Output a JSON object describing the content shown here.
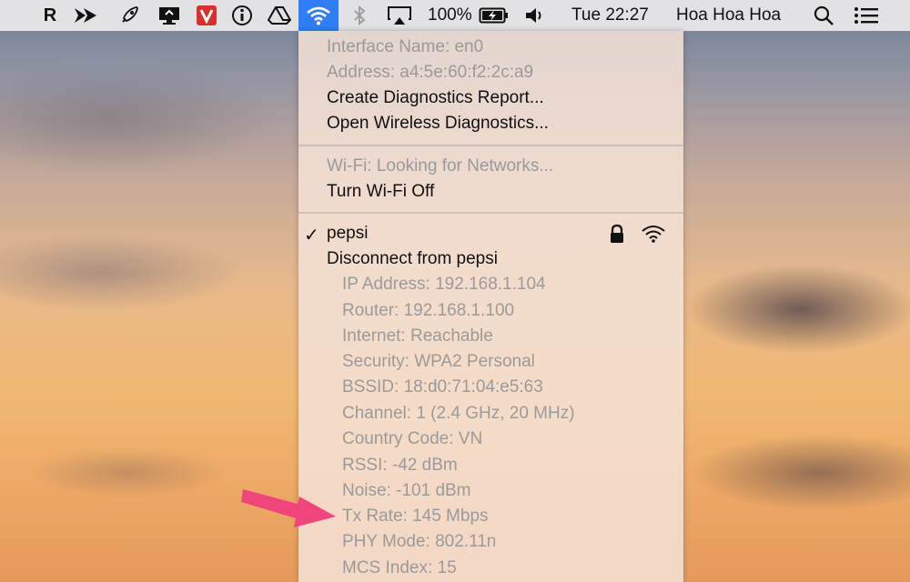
{
  "menubar": {
    "r_label": "R",
    "battery": "100%",
    "clock": "Tue 22:27",
    "user": "Hoa Hoa Hoa",
    "icons": [
      "r-app-icon",
      "forward-icon",
      "rocket-icon",
      "display-sync-icon",
      "vivaldi-icon",
      "info-icon",
      "google-drive-icon",
      "wifi-icon",
      "bluetooth-icon",
      "airplay-icon",
      "battery-charging-icon",
      "volume-icon",
      "spotlight-icon",
      "notification-center-icon"
    ]
  },
  "menu": {
    "interface_name": "Interface Name: en0",
    "address": "Address: a4:5e:60:f2:2c:a9",
    "create_report": "Create Diagnostics Report...",
    "open_diagnostics": "Open Wireless Diagnostics...",
    "wifi_status": "Wi-Fi: Looking for Networks...",
    "turn_off": "Turn Wi-Fi Off",
    "checkmark": "✓",
    "network_name": "pepsi",
    "disconnect": "Disconnect from pepsi",
    "details": {
      "ip": "IP Address: 192.168.1.104",
      "router": "Router: 192.168.1.100",
      "internet": "Internet: Reachable",
      "security": "Security: WPA2 Personal",
      "bssid": "BSSID: 18:d0:71:04:e5:63",
      "channel": "Channel: 1 (2.4 GHz, 20 MHz)",
      "country": "Country Code: VN",
      "rssi": "RSSI: -42 dBm",
      "noise": "Noise: -101 dBm",
      "tx_rate": "Tx Rate: 145 Mbps",
      "phy_mode": "PHY Mode: 802.11n",
      "mcs_index": "MCS Index: 15"
    }
  },
  "colors": {
    "accent": "#2f7ef6",
    "arrow": "#f0457a",
    "dim_text": "#9a9a9a"
  }
}
